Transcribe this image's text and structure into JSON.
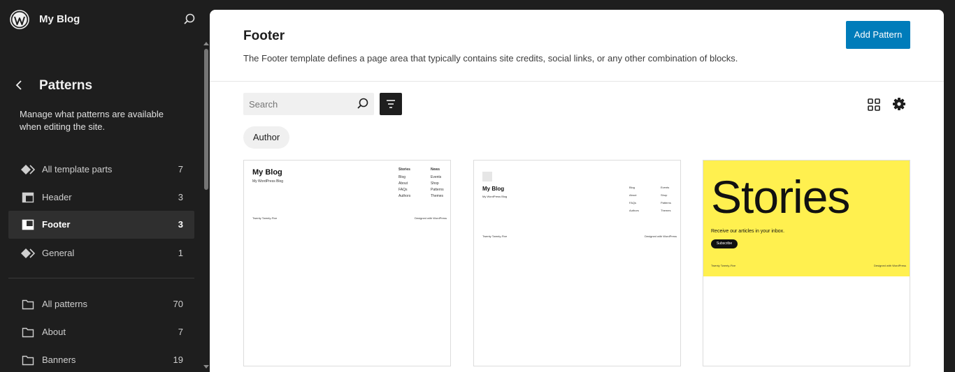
{
  "sidebar": {
    "site_title": "My Blog",
    "heading": "Patterns",
    "description": "Manage what patterns are available when editing the site.",
    "template_parts": [
      {
        "label": "All template parts",
        "count": "7",
        "icon": "symbol-icon"
      },
      {
        "label": "Header",
        "count": "3",
        "icon": "header-icon"
      },
      {
        "label": "Footer",
        "count": "3",
        "icon": "footer-icon"
      },
      {
        "label": "General",
        "count": "1",
        "icon": "symbol-icon"
      }
    ],
    "categories": [
      {
        "label": "All patterns",
        "count": "70"
      },
      {
        "label": "About",
        "count": "7"
      },
      {
        "label": "Banners",
        "count": "19"
      }
    ]
  },
  "main": {
    "title": "Footer",
    "description": "The Footer template defines a page area that typically contains site credits, social links, or any other combination of blocks.",
    "add_button": "Add Pattern",
    "search_placeholder": "Search",
    "author_filter": "Author"
  },
  "cards": {
    "c1": {
      "title": "My Blog",
      "tagline": "My WordPress Blog",
      "col1_head": "Stories",
      "col1": [
        "Blog",
        "About",
        "FAQs",
        "Authors"
      ],
      "col2_head": "News",
      "col2": [
        "Events",
        "Shop",
        "Patterns",
        "Themes"
      ],
      "credit": "Twenty Twenty-Five",
      "designed": "Designed with WordPress"
    },
    "c2": {
      "title": "My Blog",
      "tagline": "My WordPress Blog",
      "col1": [
        "Blog",
        "About",
        "FAQs",
        "Authors"
      ],
      "col2": [
        "Events",
        "Shop",
        "Patterns",
        "Themes"
      ],
      "credit": "Twenty Twenty-Five",
      "designed": "Designed with WordPress"
    },
    "c3": {
      "headline": "Stories",
      "subtext": "Receive our articles in your inbox.",
      "button": "Subscribe",
      "credit": "Twenty Twenty-Five",
      "designed": "Designed with WordPress"
    }
  },
  "colors": {
    "accent": "#007cba",
    "sidebar_bg": "#1e1e1e",
    "active_item_bg": "#2f2f2f",
    "card3_bg": "#fff04f"
  }
}
